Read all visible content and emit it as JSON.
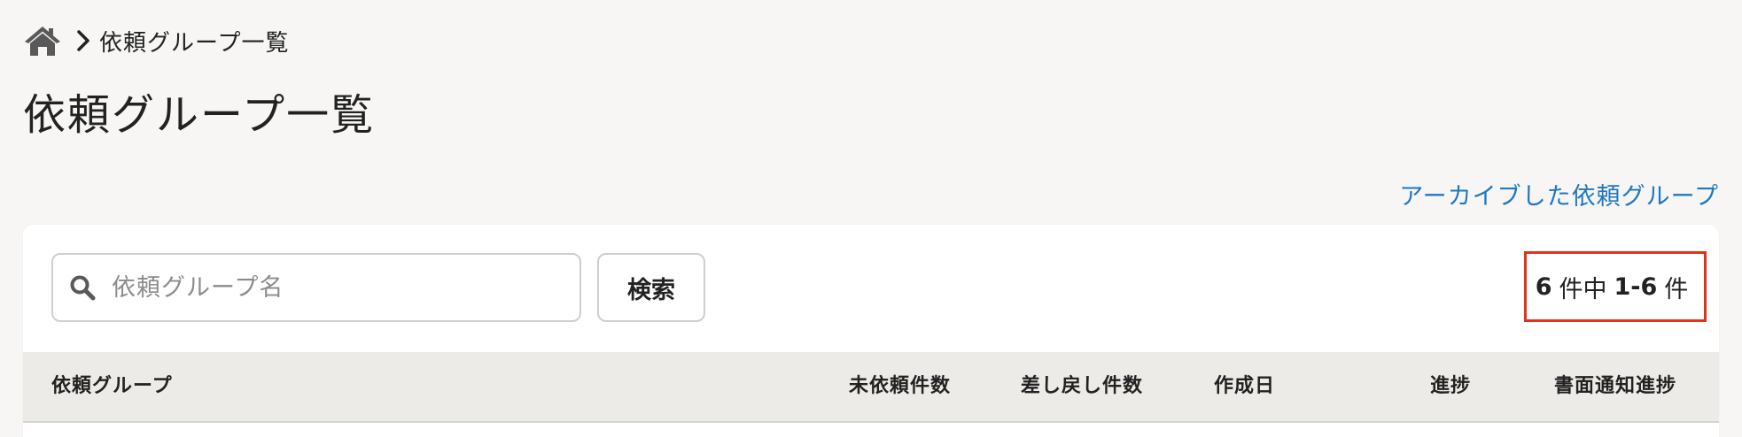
{
  "breadcrumb": {
    "home_icon": "home-icon",
    "separator_icon": "chevron-right-icon",
    "current": "依頼グループ一覧"
  },
  "page": {
    "title": "依頼グループ一覧"
  },
  "archive_link": {
    "label": "アーカイブした依頼グループ"
  },
  "search": {
    "icon": "search-icon",
    "placeholder": "依頼グループ名",
    "value": "",
    "button_label": "検索"
  },
  "result_count": {
    "total": "6",
    "total_unit": "件中",
    "range": "1-6",
    "range_unit": "件"
  },
  "table": {
    "columns": [
      "依頼グループ",
      "未依頼件数",
      "差し戻し件数",
      "作成日",
      "進捗",
      "書面通知進捗"
    ]
  },
  "colors": {
    "background": "#f7f6f4",
    "link": "#1e78c3",
    "highlight_border": "#e0331c",
    "table_header": "#ecebe7"
  }
}
